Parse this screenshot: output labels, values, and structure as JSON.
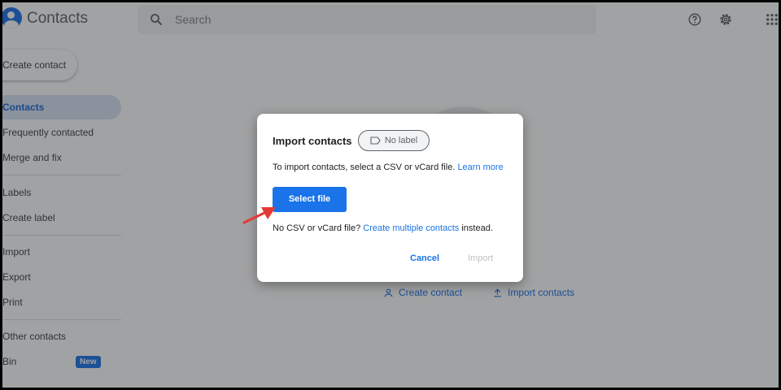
{
  "header": {
    "app_title": "Contacts",
    "search_placeholder": "Search"
  },
  "sidebar": {
    "create_label": "Create contact",
    "items": [
      {
        "label": "Contacts",
        "active": true
      },
      {
        "label": "Frequently contacted"
      },
      {
        "label": "Merge and fix"
      },
      {
        "label": "Labels"
      },
      {
        "label": "Create label"
      },
      {
        "label": "Import"
      },
      {
        "label": "Export"
      },
      {
        "label": "Print"
      },
      {
        "label": "Other contacts"
      },
      {
        "label": "Bin",
        "badge": "New"
      }
    ]
  },
  "empty_state": {
    "create_link": "Create contact",
    "import_link": "Import contacts"
  },
  "dialog": {
    "title": "Import contacts",
    "label_chip": "No label",
    "description": "To import contacts, select a CSV or vCard file.",
    "learn_more": "Learn more",
    "select_file": "Select file",
    "no_file_prefix": "No CSV or vCard file?",
    "create_multiple": "Create multiple contacts",
    "no_file_suffix": "instead.",
    "cancel": "Cancel",
    "import": "Import"
  },
  "colors": {
    "accent": "#1a73e8",
    "arrow": "#e53935"
  }
}
